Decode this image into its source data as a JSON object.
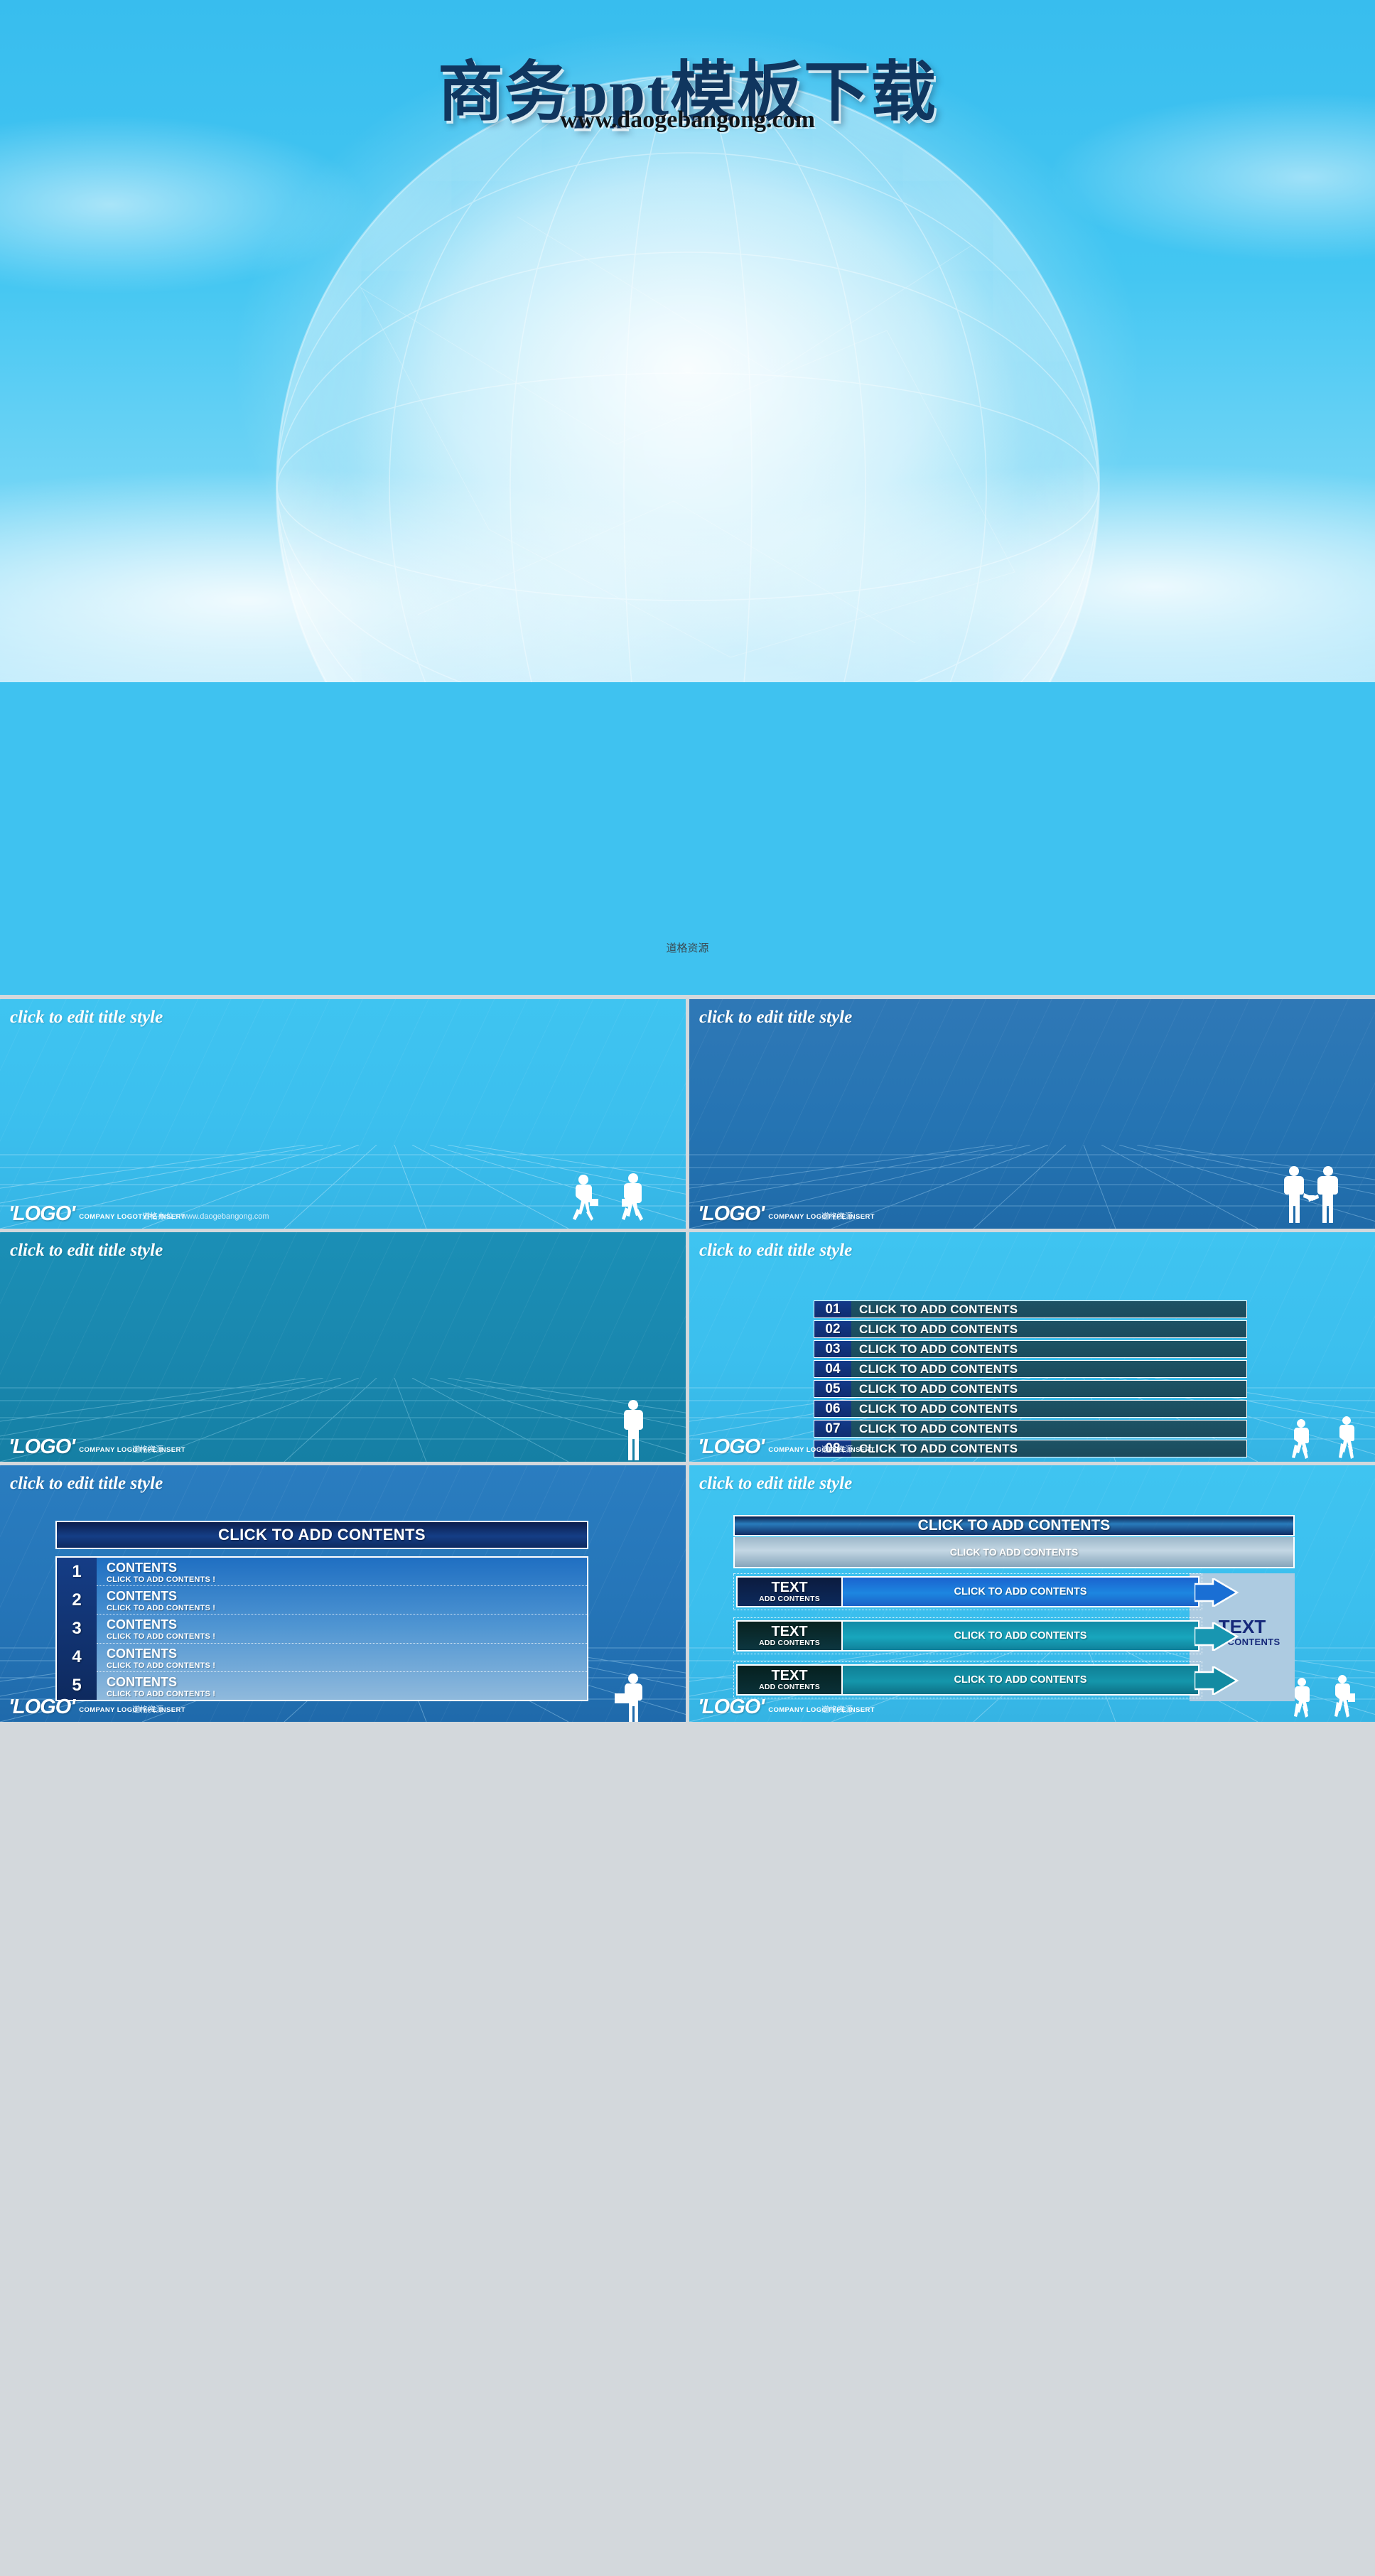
{
  "hero": {
    "title": "商务ppt模板下载",
    "url": "www.daogebangong.com",
    "credit": "道格资源"
  },
  "common": {
    "slide_title": "click to edit title style",
    "logo_word": "'LOGO'",
    "logo_sub": "COMPANY LOGOTYPE INSERT",
    "footer_note_url": "道格办公：www.daogebangong.com",
    "footer_note_short": "道格资源"
  },
  "colors": {
    "cyan": "#3fc4f1",
    "navy": "#2574b3",
    "teal": "#1987ae",
    "blue2": "#2575b8",
    "deep_navy": "#0f2d70",
    "panel_teal": "#1b4b5d",
    "right_panel": "#adcbe1",
    "text_dark_blue": "#16297a"
  },
  "slides": [
    {
      "index": 2,
      "title": "click to edit title style",
      "bg": "cyan",
      "footer_note": "道格办公：www.daogebangong.com",
      "silhouette": "two-walking-businessmen"
    },
    {
      "index": 3,
      "title": "click to edit title style",
      "bg": "navy",
      "footer_note": "道格资源",
      "silhouette": "handshake-pair"
    },
    {
      "index": 4,
      "title": "click to edit title style",
      "bg": "teal",
      "footer_note": "道格资源",
      "silhouette": "standing-businessman"
    },
    {
      "index": 5,
      "title": "click to edit title style",
      "bg": "cyan",
      "footer_note": "道格资源",
      "silhouette": "two-walking-women"
    },
    {
      "index": 6,
      "title": "click to edit title style",
      "bg": "blue2",
      "footer_note": "道格资源",
      "silhouette": "man-with-box"
    },
    {
      "index": 7,
      "title": "click to edit title style",
      "bg": "cyan",
      "footer_note": "道格资源",
      "silhouette": "two-people"
    }
  ],
  "slide5_list": {
    "items": [
      {
        "num": "01",
        "label": "CLICK TO ADD CONTENTS"
      },
      {
        "num": "02",
        "label": "CLICK TO ADD CONTENTS"
      },
      {
        "num": "03",
        "label": "CLICK TO ADD CONTENTS"
      },
      {
        "num": "04",
        "label": "CLICK TO ADD CONTENTS"
      },
      {
        "num": "05",
        "label": "CLICK TO ADD CONTENTS"
      },
      {
        "num": "06",
        "label": "CLICK TO ADD CONTENTS"
      },
      {
        "num": "07",
        "label": "CLICK TO ADD CONTENTS"
      },
      {
        "num": "08",
        "label": "CLICK TO ADD CONTENTS"
      }
    ]
  },
  "slide6": {
    "header": "CLICK TO ADD CONTENTS",
    "rows": [
      {
        "num": "1",
        "title": "CONTENTS",
        "sub": "CLICK TO ADD CONTENTS !"
      },
      {
        "num": "2",
        "title": "CONTENTS",
        "sub": "CLICK TO ADD CONTENTS !"
      },
      {
        "num": "3",
        "title": "CONTENTS",
        "sub": "CLICK TO ADD CONTENTS !"
      },
      {
        "num": "4",
        "title": "CONTENTS",
        "sub": "CLICK TO ADD CONTENTS !"
      },
      {
        "num": "5",
        "title": "CONTENTS",
        "sub": "CLICK TO ADD CONTENTS !"
      }
    ]
  },
  "slide7": {
    "header": "CLICK TO ADD CONTENTS",
    "subheader": "CLICK TO ADD CONTENTS",
    "right_panel": {
      "title": "TEXT",
      "sub": "ADD CONTENTS"
    },
    "rows": [
      {
        "tag": "TEXT",
        "tag_sub": "ADD CONTENTS",
        "body": "CLICK TO ADD CONTENTS"
      },
      {
        "tag": "TEXT",
        "tag_sub": "ADD CONTENTS",
        "body": "CLICK TO ADD CONTENTS"
      },
      {
        "tag": "TEXT",
        "tag_sub": "ADD CONTENTS",
        "body": "CLICK TO ADD CONTENTS"
      }
    ]
  }
}
